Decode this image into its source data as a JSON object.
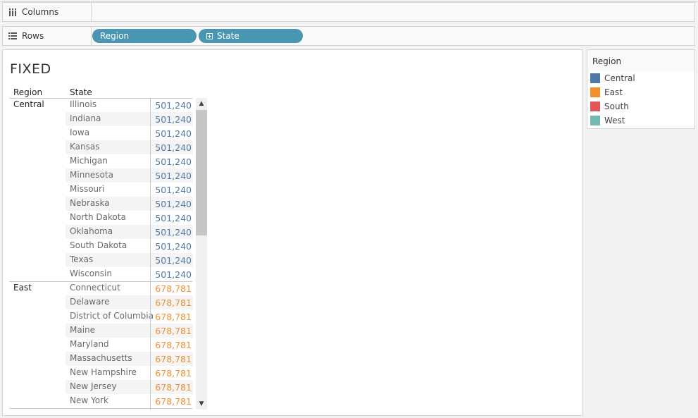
{
  "shelves": {
    "columns": {
      "label": "Columns",
      "icon": "columns-icon",
      "pills": []
    },
    "rows": {
      "label": "Rows",
      "icon": "rows-icon",
      "pills": [
        {
          "label": "Region",
          "expandable": false
        },
        {
          "label": "State",
          "expandable": true
        }
      ]
    }
  },
  "view": {
    "title": "FIXED",
    "headers": {
      "region": "Region",
      "state": "State"
    },
    "groups": [
      {
        "region": "Central",
        "color": "#4e79a7",
        "rows": [
          {
            "state": "Illinois",
            "value": "501,240"
          },
          {
            "state": "Indiana",
            "value": "501,240"
          },
          {
            "state": "Iowa",
            "value": "501,240"
          },
          {
            "state": "Kansas",
            "value": "501,240"
          },
          {
            "state": "Michigan",
            "value": "501,240"
          },
          {
            "state": "Minnesota",
            "value": "501,240"
          },
          {
            "state": "Missouri",
            "value": "501,240"
          },
          {
            "state": "Nebraska",
            "value": "501,240"
          },
          {
            "state": "North Dakota",
            "value": "501,240"
          },
          {
            "state": "Oklahoma",
            "value": "501,240"
          },
          {
            "state": "South Dakota",
            "value": "501,240"
          },
          {
            "state": "Texas",
            "value": "501,240"
          },
          {
            "state": "Wisconsin",
            "value": "501,240"
          }
        ]
      },
      {
        "region": "East",
        "color": "#f28e2b",
        "rows": [
          {
            "state": "Connecticut",
            "value": "678,781"
          },
          {
            "state": "Delaware",
            "value": "678,781"
          },
          {
            "state": "District of Columbia",
            "value": "678,781"
          },
          {
            "state": "Maine",
            "value": "678,781"
          },
          {
            "state": "Maryland",
            "value": "678,781"
          },
          {
            "state": "Massachusetts",
            "value": "678,781"
          },
          {
            "state": "New Hampshire",
            "value": "678,781"
          },
          {
            "state": "New Jersey",
            "value": "678,781"
          },
          {
            "state": "New York",
            "value": "678,781"
          }
        ]
      }
    ]
  },
  "legend": {
    "title": "Region",
    "items": [
      {
        "label": "Central",
        "color": "#4e79a7"
      },
      {
        "label": "East",
        "color": "#f28e2b"
      },
      {
        "label": "South",
        "color": "#e15759"
      },
      {
        "label": "West",
        "color": "#76b7b2"
      }
    ]
  }
}
